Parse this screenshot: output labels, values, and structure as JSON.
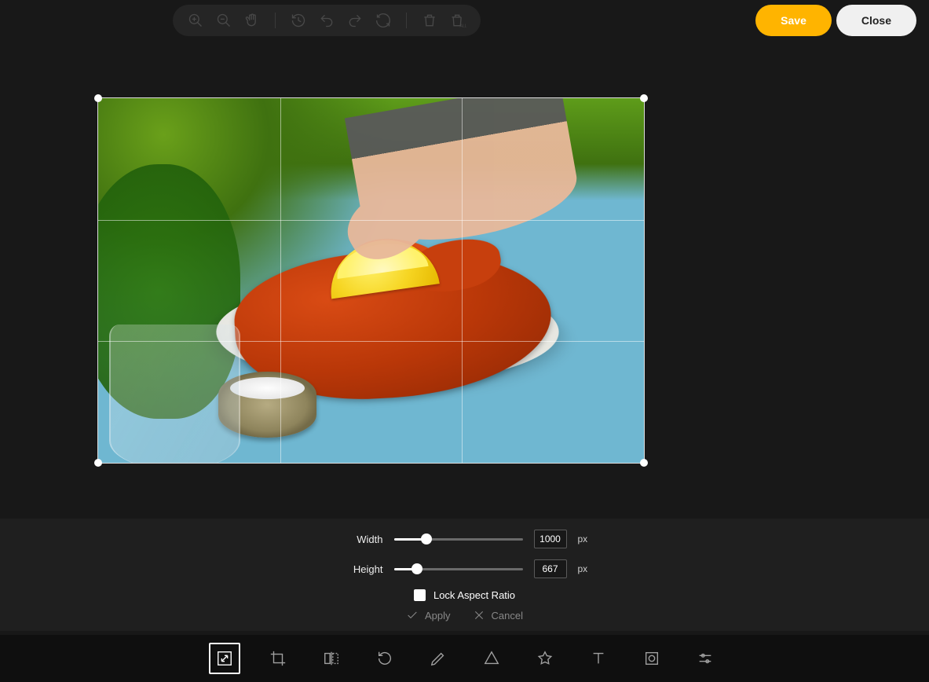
{
  "topbar": {
    "save_label": "Save",
    "close_label": "Close"
  },
  "controls": {
    "width_label": "Width",
    "height_label": "Height",
    "width_value": "1000",
    "height_value": "667",
    "unit": "px",
    "lock_aspect_label": "Lock Aspect Ratio",
    "apply_label": "Apply",
    "cancel_label": "Cancel",
    "width_slider_percent": 25,
    "height_slider_percent": 18
  }
}
